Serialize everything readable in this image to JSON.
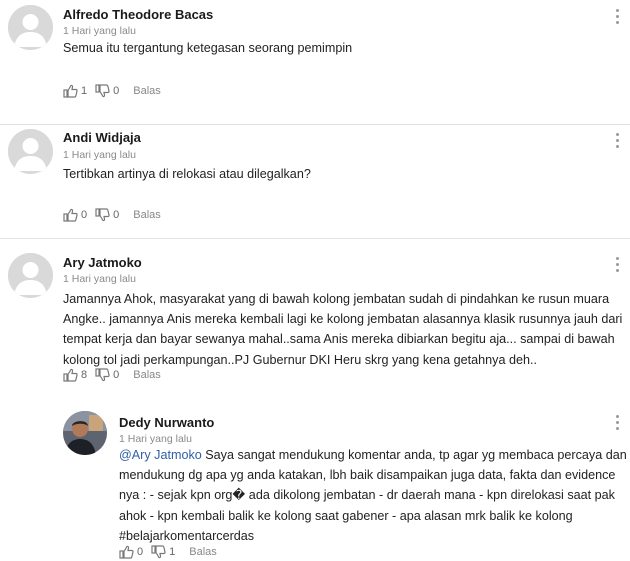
{
  "comments": [
    {
      "author": "Alfredo Theodore Bacas",
      "time": "1 Hari yang lalu",
      "text": "Semua itu tergantung ketegasan seorang pemimpin",
      "likes": "1",
      "dislikes": "0",
      "reply": "Balas"
    },
    {
      "author": "Andi Widjaja",
      "time": "1 Hari yang lalu",
      "text": "Tertibkan artinya di relokasi atau dilegalkan?",
      "likes": "0",
      "dislikes": "0",
      "reply": "Balas"
    },
    {
      "author": "Ary Jatmoko",
      "time": "1 Hari yang lalu",
      "text_lines": [
        "Jamannya Ahok, masyarakat yang di bawah kolong jembatan sudah di pindahkan ke rusun muara",
        "Angke.. jamannya Anis mereka kembali lagi ke kolong jembatan alasannya klasik rusunnya jauh dari",
        "tempat kerja dan bayar sewanya mahal..sama Anis mereka dibiarkan begitu aja... sampai di bawah",
        "kolong tol jadi perkampungan..PJ Gubernur DKI Heru skrg yang kena getahnya deh.."
      ],
      "likes": "8",
      "dislikes": "0",
      "reply": "Balas"
    }
  ],
  "reply_comment": {
    "author": "Dedy Nurwanto",
    "time": "1 Hari yang lalu",
    "mention": "@Ary Jatmoko",
    "first_line_rest": " Saya sangat mendukung komentar anda, tp agar yg membaca percaya dan",
    "text_lines": [
      "mendukung dg apa yg anda katakan, lbh baik disampaikan juga data, fakta dan evidence",
      "nya : - sejak kpn org� ada dikolong jembatan - dr daerah mana - kpn direlokasi saat pak",
      "ahok - kpn kembali balik ke kolong saat gabener - apa alasan mrk balik ke kolong",
      "#belajarkomentarcerdas"
    ],
    "likes": "0",
    "dislikes": "1",
    "reply": "Balas"
  },
  "icons": {
    "like": "thumbs-up-icon",
    "dislike": "thumbs-down-icon",
    "menu": "more-vertical-icon",
    "avatar": "default-avatar-icon"
  },
  "colors": {
    "mention": "#2f5fa6",
    "divider": "#e2e2e2",
    "avatar_placeholder": "#d9d9d9"
  }
}
